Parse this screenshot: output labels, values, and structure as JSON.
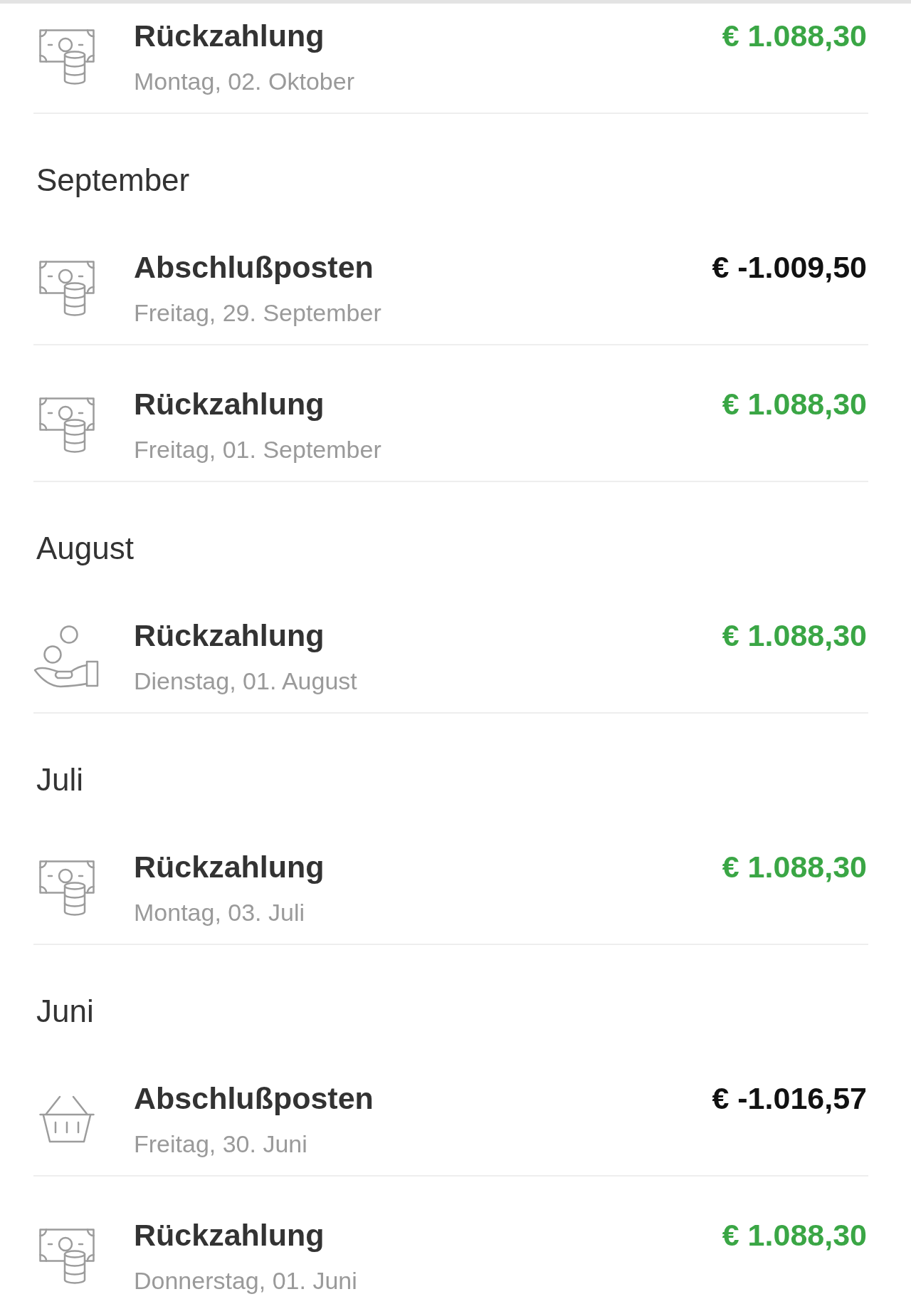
{
  "sections": [
    {
      "transactions": [
        {
          "kind": "banknote",
          "title": "Rückzahlung",
          "date": "Montag, 02. Oktober",
          "amount": "€ 1.088,30",
          "credit": true
        }
      ]
    },
    {
      "heading": "September",
      "transactions": [
        {
          "kind": "banknote",
          "title": "Abschlußposten",
          "date": "Freitag, 29. September",
          "amount": "€ -1.009,50",
          "credit": false
        },
        {
          "kind": "banknote",
          "title": "Rückzahlung",
          "date": "Freitag, 01. September",
          "amount": "€ 1.088,30",
          "credit": true
        }
      ]
    },
    {
      "heading": "August",
      "transactions": [
        {
          "kind": "hand",
          "title": "Rückzahlung",
          "date": "Dienstag, 01. August",
          "amount": "€ 1.088,30",
          "credit": true
        }
      ]
    },
    {
      "heading": "Juli",
      "transactions": [
        {
          "kind": "banknote",
          "title": "Rückzahlung",
          "date": "Montag, 03. Juli",
          "amount": "€ 1.088,30",
          "credit": true
        }
      ]
    },
    {
      "heading": "Juni",
      "transactions": [
        {
          "kind": "basket",
          "title": "Abschlußposten",
          "date": "Freitag, 30. Juni",
          "amount": "€ -1.016,57",
          "credit": false
        },
        {
          "kind": "banknote",
          "title": "Rückzahlung",
          "date": "Donnerstag, 01. Juni",
          "amount": "€ 1.088,30",
          "credit": true
        }
      ]
    }
  ]
}
